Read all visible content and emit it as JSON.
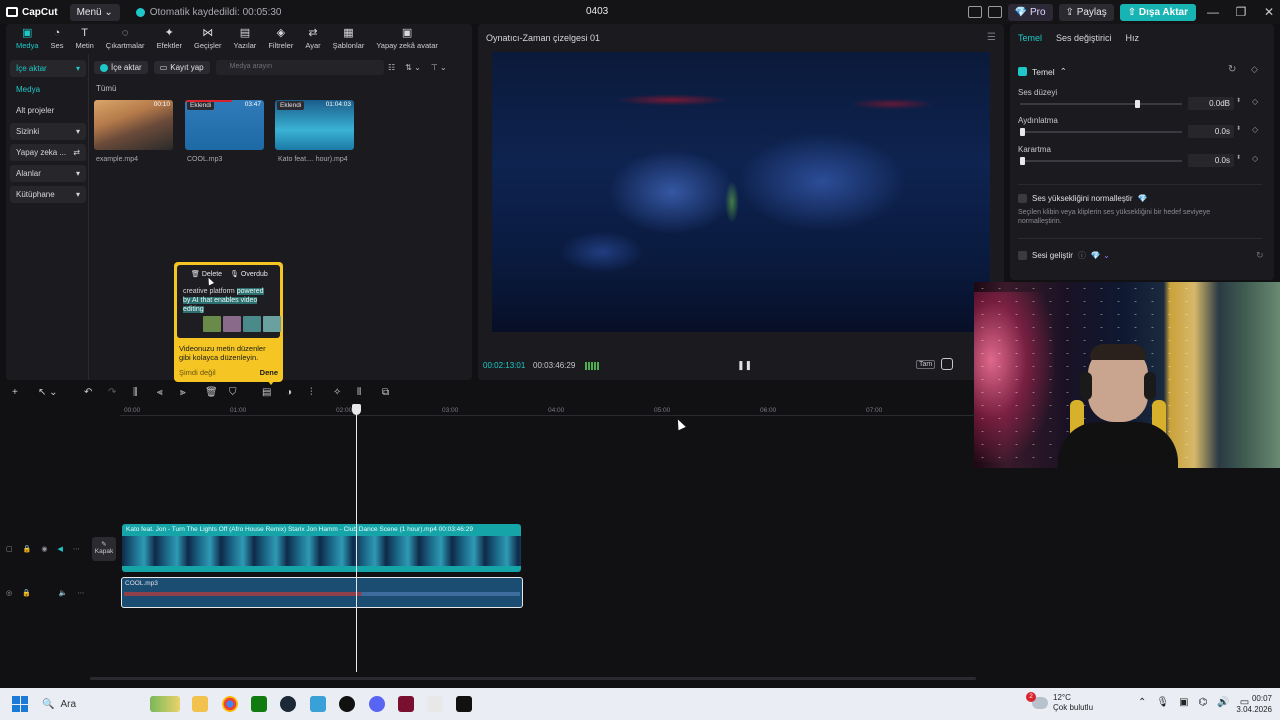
{
  "titlebar": {
    "logo": "CapCut",
    "menu_label": "Menü",
    "autosave": "Otomatik kaydedildi: 00:05:30",
    "project_title": "0403",
    "pro_label": "Pro",
    "share_label": "Paylaş",
    "export_label": "Dışa Aktar",
    "controls": [
      "—",
      "❐",
      "✕"
    ]
  },
  "toptabs": [
    {
      "icon": "▣",
      "label": "Medya",
      "active": true
    },
    {
      "icon": "◔",
      "label": "Ses"
    },
    {
      "icon": "T",
      "label": "Metin"
    },
    {
      "icon": "◌",
      "label": "Çıkartmalar"
    },
    {
      "icon": "✦",
      "label": "Efektler"
    },
    {
      "icon": "⋈",
      "label": "Geçişler"
    },
    {
      "icon": "▤",
      "label": "Yazılar"
    },
    {
      "icon": "◈",
      "label": "Filtreler"
    },
    {
      "icon": "⇄",
      "label": "Ayar"
    },
    {
      "icon": "▦",
      "label": "Şablonlar"
    },
    {
      "icon": "▣",
      "label": "Yapay zekâ avatar"
    }
  ],
  "sidenav": [
    {
      "label": "İçe aktar",
      "chevron": "▾",
      "active": true
    },
    {
      "label": "Medya",
      "sub": true
    },
    {
      "label": "Alt projeler",
      "plain": true
    },
    {
      "label": "Sizinki",
      "chevron": "▾"
    },
    {
      "label": "Yapay zeka ...",
      "chevron": "⇄"
    },
    {
      "label": "Alanlar",
      "chevron": "▾"
    },
    {
      "label": "Kütüphane",
      "chevron": "▾"
    }
  ],
  "media": {
    "import_label": "İçe aktar",
    "record_label": "Kayıt yap",
    "search_placeholder": "Medya arayın",
    "all_label": "Tümü",
    "items": [
      {
        "name": "example.mp4",
        "badge": "",
        "duration": "00:10"
      },
      {
        "name": "COOL.mp3",
        "badge": "Eklendi",
        "duration": "03:47"
      },
      {
        "name": "Kato feat.... hour).mp4",
        "badge": "Eklendi",
        "duration": "01:04:03"
      }
    ]
  },
  "tooltip": {
    "delete_label": "Delete",
    "overdub_label": "Overdub",
    "line1_plain": "creative platform ",
    "line1_hl": "powered",
    "line2": "by AI that enables video",
    "line3": "editing",
    "body": "Videonuzu metin düzenler gibi kolayca düzenleyin.",
    "not_now": "Şimdi değil",
    "try_label": "Dene"
  },
  "player": {
    "title": "Oynatıcı-Zaman çizelgesi 01",
    "current_time": "00:02:13:01",
    "total_time": "00:03:46:29",
    "ratio_label": "Tam"
  },
  "rightpanel": {
    "tabs": [
      {
        "label": "Temel",
        "active": true
      },
      {
        "label": "Ses değiştirici"
      },
      {
        "label": "Hız"
      }
    ],
    "section_label": "Temel",
    "rows": [
      {
        "label": "Ses düzeyi",
        "value": "0.0dB",
        "fraction": 0.73
      },
      {
        "label": "Aydınlatma",
        "value": "0.0s",
        "fraction": 0.0
      },
      {
        "label": "Karartma",
        "value": "0.0s",
        "fraction": 0.0
      }
    ],
    "normalize_label": "Ses yüksekliğini normalleştir",
    "normalize_desc": "Seçilen klibin veya kliplerin ses yüksekliğini bir hedef seviyeye normalleştirin.",
    "enhance_label": "Sesi geliştir"
  },
  "timeline": {
    "ticks": [
      "00:00",
      "01:00",
      "02:00",
      "03:00",
      "04:00",
      "05:00",
      "06:00",
      "07:00"
    ],
    "cover_label": "Kapak",
    "video_clip_title": "Kato feat. Jon - Turn The Lights Off (Afro House Remix) Starix Jon Hamm - Club Dance Scene (1 hour).mp4  00:03:46:29",
    "audio_clip_title": "COOL.mp3"
  },
  "taskbar": {
    "search_label": "Ara",
    "weather_temp": "12°C",
    "weather_desc": "Çok bulutlu",
    "weather_badge": "2",
    "time": "00:07",
    "date": "3.04.2026"
  }
}
